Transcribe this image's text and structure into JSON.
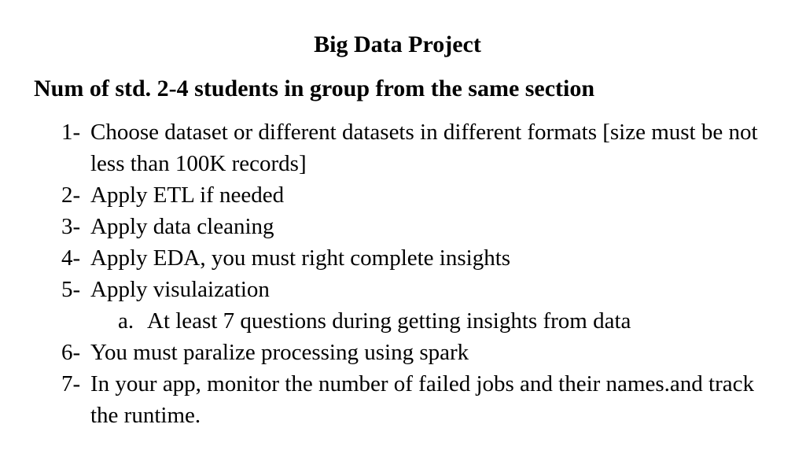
{
  "document": {
    "title": "Big Data Project",
    "subtitle": "Num of std. 2-4 students in group from the same section",
    "items": [
      {
        "num": "1-",
        "text": "Choose dataset or different datasets in different formats [size must be not less than 100K records]"
      },
      {
        "num": "2-",
        "text": "Apply ETL if needed"
      },
      {
        "num": "3-",
        "text": "Apply data cleaning"
      },
      {
        "num": "4-",
        "text": "Apply EDA, you must right complete insights"
      },
      {
        "num": "5-",
        "text": "Apply visulaization"
      },
      {
        "num": "6-",
        "text": "You must paralize processing using spark"
      },
      {
        "num": "7-",
        "text": "In your app, monitor the number of failed jobs and their names.and track the runtime."
      }
    ],
    "subitem": {
      "num": "a.",
      "text": "At least 7 questions during getting insights from data"
    }
  }
}
